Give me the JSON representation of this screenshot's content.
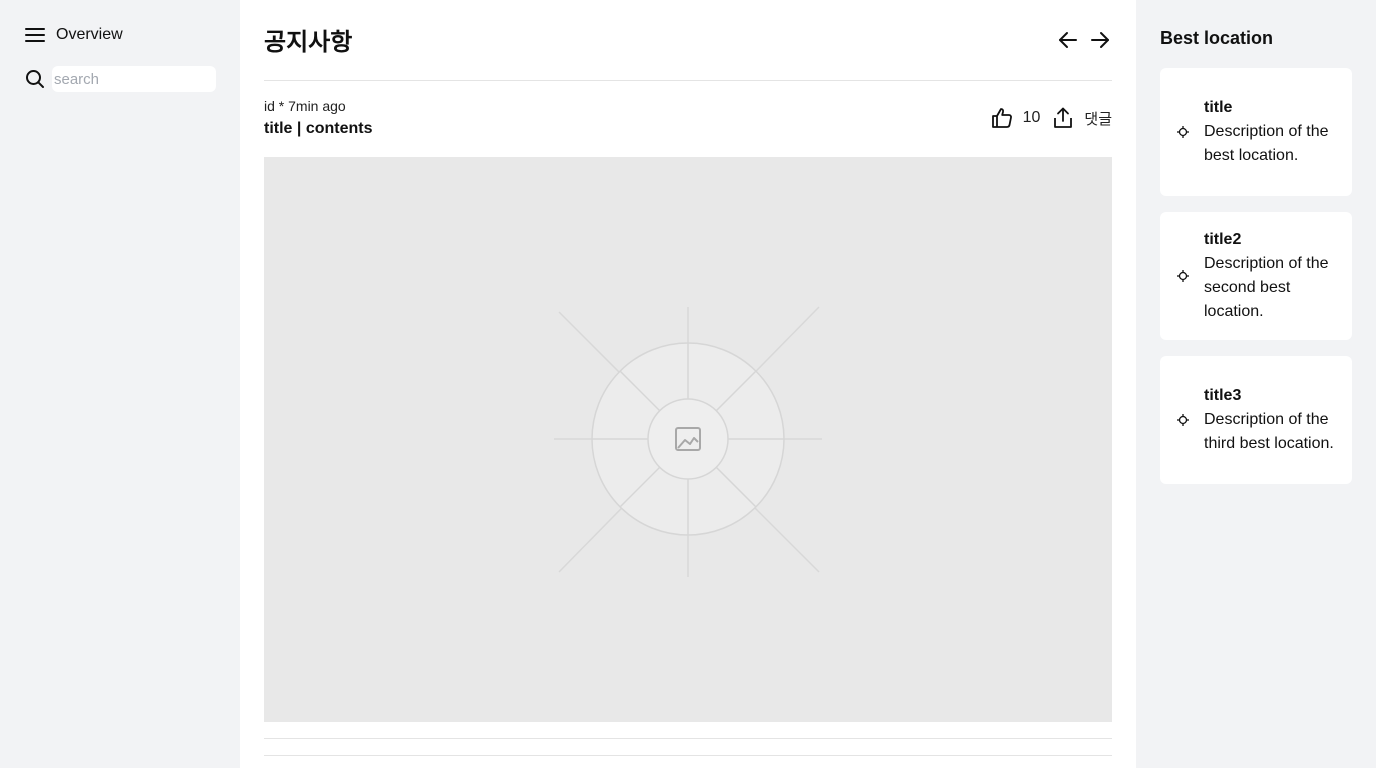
{
  "sidebar": {
    "title": "Overview",
    "search_placeholder": "search"
  },
  "main": {
    "title": "공지사항",
    "post": {
      "meta": "id * 7min ago",
      "title": "title | contents",
      "likes": "10",
      "comment_label": "댓글"
    }
  },
  "right": {
    "title": "Best location",
    "cards": [
      {
        "title": "title",
        "description": "Description of the best location."
      },
      {
        "title": "title2",
        "description": "Description of the second best location."
      },
      {
        "title": "title3",
        "description": "Description of the third best location."
      }
    ]
  },
  "icons": {
    "menu": "menu-icon",
    "search": "search-icon",
    "back": "arrow-left-icon",
    "forward": "arrow-right-icon",
    "like": "thumbs-up-icon",
    "share": "share-icon",
    "pin": "location-pin-icon",
    "image": "image-icon"
  },
  "colors": {
    "side_background": "#f2f3f5",
    "main_background": "#ffffff",
    "placeholder_background": "#e8e8e8"
  }
}
